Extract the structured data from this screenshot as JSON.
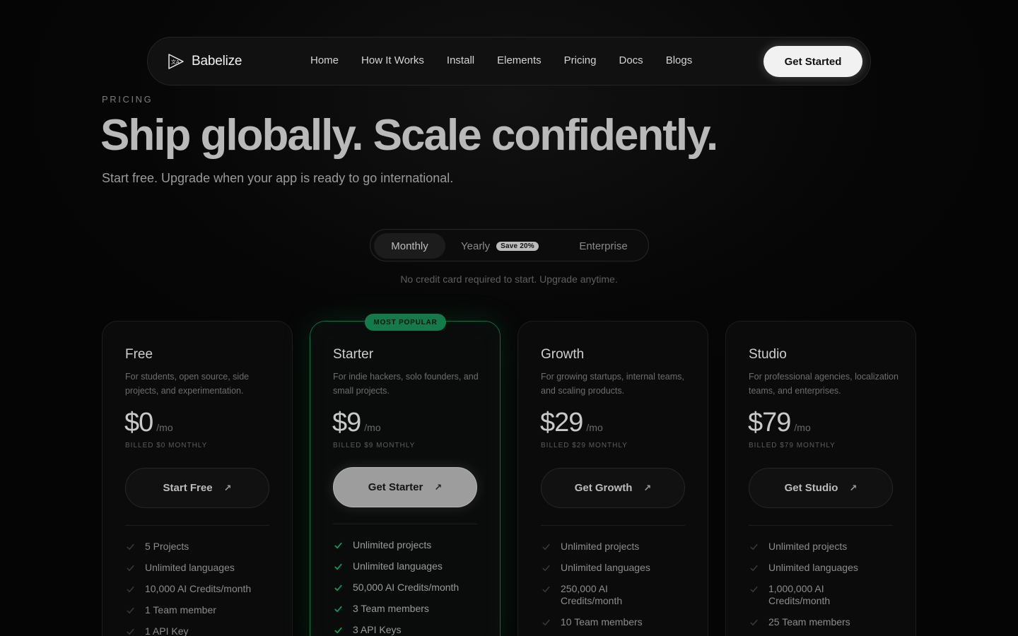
{
  "nav": {
    "brand": "Babelize",
    "links": [
      "Home",
      "How It Works",
      "Install",
      "Elements",
      "Pricing",
      "Docs",
      "Blogs"
    ],
    "cta": "Get Started"
  },
  "hero": {
    "eyebrow": "PRICING",
    "title": "Ship globally. Scale confidently.",
    "subtitle": "Start free. Upgrade when your app is ready to go international."
  },
  "billing_toggle": {
    "monthly": "Monthly",
    "yearly": "Yearly",
    "yearly_badge": "Save 20%",
    "enterprise": "Enterprise",
    "selected": "Monthly",
    "note": "No credit card required to start. Upgrade anytime."
  },
  "popular_badge": "MOST POPULAR",
  "colors": {
    "accent_green": "#137a49",
    "background": "#060606"
  },
  "plans": [
    {
      "name": "Free",
      "description": "For students, open source, side projects, and experimentation.",
      "price": "$0",
      "period": "/mo",
      "billed": "BILLED $0 MONTHLY",
      "cta": "Start Free",
      "features": [
        "5 Projects",
        "Unlimited languages",
        "10,000 AI Credits/month",
        "1 Team member",
        "1 API Key"
      ]
    },
    {
      "name": "Starter",
      "description": "For indie hackers, solo founders, and small projects.",
      "price": "$9",
      "period": "/mo",
      "billed": "BILLED $9 MONTHLY",
      "cta": "Get Starter",
      "featured": true,
      "features": [
        "Unlimited projects",
        "Unlimited languages",
        "50,000 AI Credits/month",
        "3 Team members",
        "3 API Keys"
      ]
    },
    {
      "name": "Growth",
      "description": "For growing startups, internal teams, and scaling products.",
      "price": "$29",
      "period": "/mo",
      "billed": "BILLED $29 MONTHLY",
      "cta": "Get Growth",
      "features": [
        "Unlimited projects",
        "Unlimited languages",
        "250,000 AI Credits/month",
        "10 Team members"
      ]
    },
    {
      "name": "Studio",
      "description": "For professional agencies, localization teams, and enterprises.",
      "price": "$79",
      "period": "/mo",
      "billed": "BILLED $79 MONTHLY",
      "cta": "Get Studio",
      "features": [
        "Unlimited projects",
        "Unlimited languages",
        "1,000,000 AI Credits/month",
        "25 Team members"
      ]
    }
  ]
}
